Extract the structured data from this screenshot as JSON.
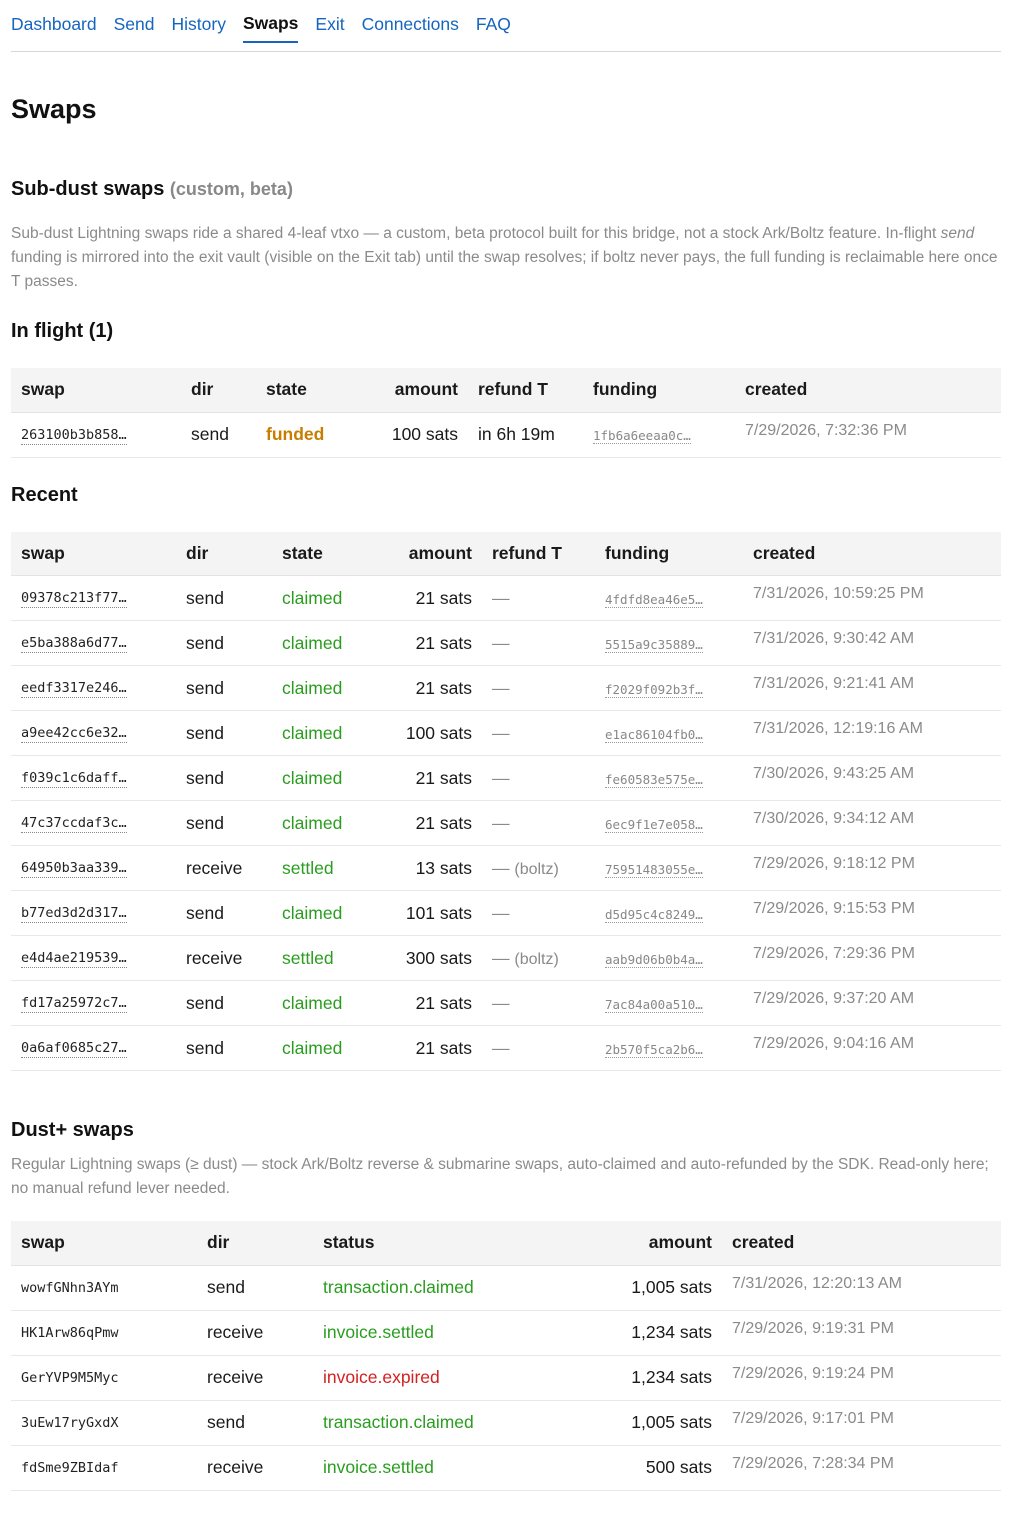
{
  "nav": {
    "items": [
      {
        "label": "Dashboard",
        "active": false
      },
      {
        "label": "Send",
        "active": false
      },
      {
        "label": "History",
        "active": false
      },
      {
        "label": "Swaps",
        "active": true
      },
      {
        "label": "Exit",
        "active": false
      },
      {
        "label": "Connections",
        "active": false
      },
      {
        "label": "FAQ",
        "active": false
      }
    ]
  },
  "page_title": "Swaps",
  "subdust": {
    "title": "Sub-dust swaps",
    "title_suffix": "(custom, beta)",
    "desc_before": "Sub-dust Lightning swaps ride a shared 4-leaf vtxo — a custom, beta protocol built for this bridge, not a stock Ark/Boltz feature. In-flight ",
    "desc_italic": "send",
    "desc_after": " funding is mirrored into the exit vault (visible on the Exit tab) until the swap resolves; if boltz never pays, the full funding is reclaimable here once T passes.",
    "columns": [
      "swap",
      "dir",
      "state",
      "amount",
      "refund T",
      "funding",
      "created"
    ]
  },
  "inflight": {
    "title": "In flight (1)",
    "rows": [
      {
        "swap": "263100b3b858…",
        "dir": "send",
        "state": "funded",
        "state_color": "orange",
        "amount": "100 sats",
        "refund": "in 6h 19m",
        "refund_note": "",
        "funding": "1fb6a6eeaa0c…",
        "created": "7/29/2026, 7:32:36 PM"
      }
    ]
  },
  "recent": {
    "title": "Recent",
    "rows": [
      {
        "swap": "09378c213f77…",
        "dir": "send",
        "state": "claimed",
        "state_color": "green",
        "amount": "21 sats",
        "refund": "—",
        "refund_note": "",
        "funding": "4fdfd8ea46e5…",
        "created": "7/31/2026, 10:59:25 PM"
      },
      {
        "swap": "e5ba388a6d77…",
        "dir": "send",
        "state": "claimed",
        "state_color": "green",
        "amount": "21 sats",
        "refund": "—",
        "refund_note": "",
        "funding": "5515a9c35889…",
        "created": "7/31/2026, 9:30:42 AM"
      },
      {
        "swap": "eedf3317e246…",
        "dir": "send",
        "state": "claimed",
        "state_color": "green",
        "amount": "21 sats",
        "refund": "—",
        "refund_note": "",
        "funding": "f2029f092b3f…",
        "created": "7/31/2026, 9:21:41 AM"
      },
      {
        "swap": "a9ee42cc6e32…",
        "dir": "send",
        "state": "claimed",
        "state_color": "green",
        "amount": "100 sats",
        "refund": "—",
        "refund_note": "",
        "funding": "e1ac86104fb0…",
        "created": "7/31/2026, 12:19:16 AM"
      },
      {
        "swap": "f039c1c6daff…",
        "dir": "send",
        "state": "claimed",
        "state_color": "green",
        "amount": "21 sats",
        "refund": "—",
        "refund_note": "",
        "funding": "fe60583e575e…",
        "created": "7/30/2026, 9:43:25 AM"
      },
      {
        "swap": "47c37ccdaf3c…",
        "dir": "send",
        "state": "claimed",
        "state_color": "green",
        "amount": "21 sats",
        "refund": "—",
        "refund_note": "",
        "funding": "6ec9f1e7e058…",
        "created": "7/30/2026, 9:34:12 AM"
      },
      {
        "swap": "64950b3aa339…",
        "dir": "receive",
        "state": "settled",
        "state_color": "green",
        "amount": "13 sats",
        "refund": "—",
        "refund_note": "(boltz)",
        "funding": "75951483055e…",
        "created": "7/29/2026, 9:18:12 PM"
      },
      {
        "swap": "b77ed3d2d317…",
        "dir": "send",
        "state": "claimed",
        "state_color": "green",
        "amount": "101 sats",
        "refund": "—",
        "refund_note": "",
        "funding": "d5d95c4c8249…",
        "created": "7/29/2026, 9:15:53 PM"
      },
      {
        "swap": "e4d4ae219539…",
        "dir": "receive",
        "state": "settled",
        "state_color": "green",
        "amount": "300 sats",
        "refund": "—",
        "refund_note": "(boltz)",
        "funding": "aab9d06b0b4a…",
        "created": "7/29/2026, 7:29:36 PM"
      },
      {
        "swap": "fd17a25972c7…",
        "dir": "send",
        "state": "claimed",
        "state_color": "green",
        "amount": "21 sats",
        "refund": "—",
        "refund_note": "",
        "funding": "7ac84a00a510…",
        "created": "7/29/2026, 9:37:20 AM"
      },
      {
        "swap": "0a6af0685c27…",
        "dir": "send",
        "state": "claimed",
        "state_color": "green",
        "amount": "21 sats",
        "refund": "—",
        "refund_note": "",
        "funding": "2b570f5ca2b6…",
        "created": "7/29/2026, 9:04:16 AM"
      }
    ]
  },
  "dustplus": {
    "title": "Dust+ swaps",
    "desc": "Regular Lightning swaps (≥ dust) — stock Ark/Boltz reverse & submarine swaps, auto-claimed and auto-refunded by the SDK. Read-only here; no manual refund lever needed.",
    "columns": [
      "swap",
      "dir",
      "status",
      "amount",
      "created"
    ],
    "rows": [
      {
        "swap": "wowfGNhn3AYm",
        "dir": "send",
        "status": "transaction.claimed",
        "status_color": "green",
        "amount": "1,005 sats",
        "created": "7/31/2026, 12:20:13 AM"
      },
      {
        "swap": "HK1Arw86qPmw",
        "dir": "receive",
        "status": "invoice.settled",
        "status_color": "green",
        "amount": "1,234 sats",
        "created": "7/29/2026, 9:19:31 PM"
      },
      {
        "swap": "GerYVP9M5Myc",
        "dir": "receive",
        "status": "invoice.expired",
        "status_color": "red",
        "amount": "1,234 sats",
        "created": "7/29/2026, 9:19:24 PM"
      },
      {
        "swap": "3uEw17ryGxdX",
        "dir": "send",
        "status": "transaction.claimed",
        "status_color": "green",
        "amount": "1,005 sats",
        "created": "7/29/2026, 9:17:01 PM"
      },
      {
        "swap": "fdSme9ZBIdaf",
        "dir": "receive",
        "status": "invoice.settled",
        "status_color": "green",
        "amount": "500 sats",
        "created": "7/29/2026, 7:28:34 PM"
      }
    ]
  },
  "colors": {
    "link": "#1565c0",
    "green": "#2a9d1f",
    "orange": "#c77d00",
    "red": "#d42020",
    "muted": "#8a8a8a"
  }
}
